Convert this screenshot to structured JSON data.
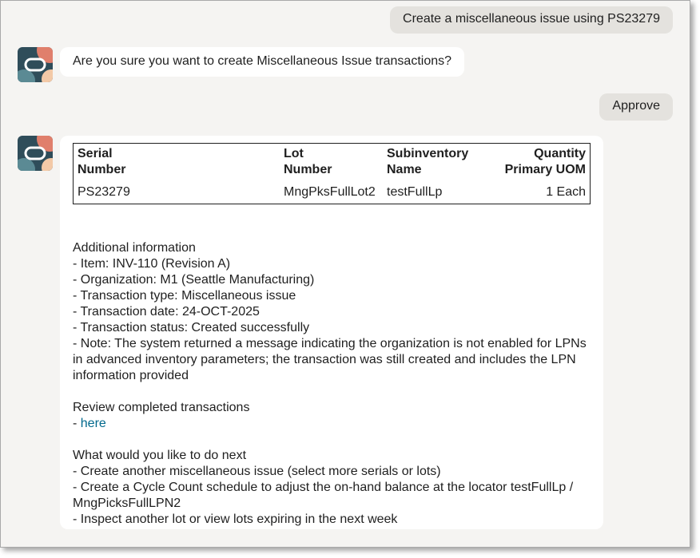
{
  "messages": {
    "user_1": "Create a miscellaneous issue using PS23279",
    "bot_1": "Are you sure you want to create Miscellaneous Issue transactions?",
    "user_2": "Approve"
  },
  "result_table": {
    "headers": {
      "serial_line1": "Serial",
      "serial_line2": "Number",
      "lot_line1": "Lot",
      "lot_line2": "Number",
      "subinv_line1": "Subinventory",
      "subinv_line2": "Name",
      "qty_line1": "Quantity",
      "qty_line2": "Primary UOM"
    },
    "rows": [
      {
        "serial": "PS23279",
        "lot": "MngPksFullLot2",
        "subinventory": "testFullLp",
        "quantity": "1 Each"
      }
    ]
  },
  "additional_info": {
    "heading": "Additional information",
    "lines": [
      "- Item: INV-110 (Revision A)",
      "- Organization: M1 (Seattle Manufacturing)",
      "- Transaction type: Miscellaneous issue",
      "- Transaction date: 24-OCT-2025",
      "- Transaction status: Created successfully",
      "- Note: The system returned a message indicating the organization is not enabled for LPNs in advanced inventory parameters; the transaction was still created and includes the LPN information provided"
    ]
  },
  "review": {
    "heading": "Review completed transactions",
    "prefix": "- ",
    "link_label": "here"
  },
  "next_steps": {
    "heading": "What would you like to do next",
    "lines": [
      "- Create another miscellaneous issue (select more serials or lots)",
      "- Create a Cycle Count schedule to adjust the on-hand balance at the locator testFullLp / MngPicksFullLPN2",
      "- Inspect another lot or view lots expiring in the next week"
    ]
  },
  "icons": {
    "avatar": "assistant-avatar-icon"
  },
  "colors": {
    "background": "#f5f4f2",
    "user_bubble": "#e4e2de",
    "bot_bubble": "#ffffff",
    "link": "#00688c",
    "avatar_dark": "#2f4d5a",
    "avatar_accent": "#e07f6c"
  }
}
